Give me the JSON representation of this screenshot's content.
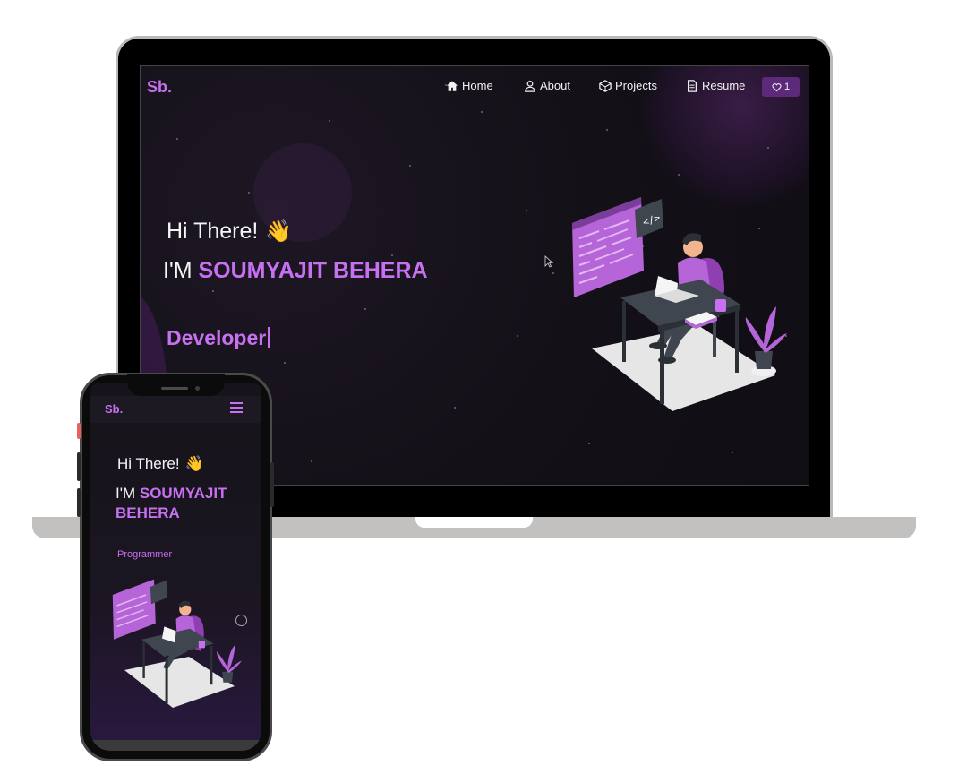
{
  "laptop_site": {
    "brand": "Sb.",
    "nav": [
      {
        "label": "Home",
        "icon": "home-icon"
      },
      {
        "label": "About",
        "icon": "user-icon"
      },
      {
        "label": "Projects",
        "icon": "projects-icon"
      },
      {
        "label": "Resume",
        "icon": "document-icon"
      }
    ],
    "fork_count": "1",
    "greeting": "Hi There!",
    "wave": "👋",
    "name_prefix": "I'M",
    "name": "SOUMYAJIT BEHERA",
    "role": "Developer"
  },
  "phone_site": {
    "brand": "Sb.",
    "greeting": "Hi There!",
    "wave": "👋",
    "name_prefix": "I'M",
    "name": "SOUMYAJIT BEHERA",
    "role": "Programmer"
  },
  "colors": {
    "accent": "#c770f0",
    "background": "#131017",
    "fork_button": "#5c2a78"
  }
}
